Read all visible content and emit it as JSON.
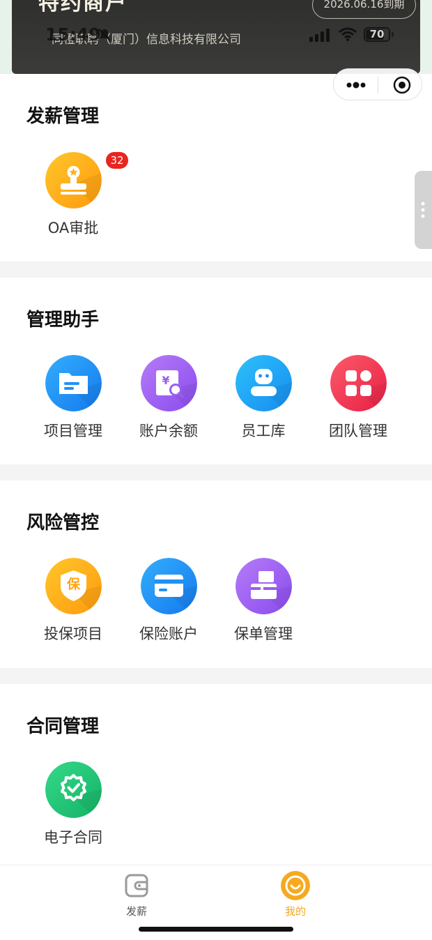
{
  "header": {
    "merchant_title": "特约商户",
    "expiry": "2026.06.16到期",
    "company": "同橙职聘（厦门）信息科技有限公司"
  },
  "status_bar": {
    "time": "15:49",
    "battery": "70"
  },
  "sections": {
    "payroll": {
      "title": "发薪管理",
      "items": [
        {
          "label": "OA审批",
          "badge": "32",
          "icon": "stamp-icon"
        }
      ]
    },
    "assistant": {
      "title": "管理助手",
      "items": [
        {
          "label": "项目管理",
          "icon": "folder-icon"
        },
        {
          "label": "账户余额",
          "icon": "balance-search-icon"
        },
        {
          "label": "员工库",
          "icon": "employee-icon"
        },
        {
          "label": "团队管理",
          "icon": "team-grid-icon"
        }
      ]
    },
    "risk": {
      "title": "风险管控",
      "items": [
        {
          "label": "投保项目",
          "icon": "shield-icon",
          "icon_text": "保"
        },
        {
          "label": "保险账户",
          "icon": "card-icon"
        },
        {
          "label": "保单管理",
          "icon": "policy-printer-icon"
        }
      ]
    },
    "contract": {
      "title": "合同管理",
      "items": [
        {
          "label": "电子合同",
          "icon": "verified-badge-icon"
        }
      ]
    }
  },
  "tabbar": {
    "tabs": [
      {
        "label": "发薪",
        "icon": "wallet-icon",
        "active": false
      },
      {
        "label": "我的",
        "icon": "smile-icon",
        "active": true
      }
    ]
  },
  "colors": {
    "accent_active": "#f4a81d",
    "badge_red": "#e8251e",
    "orange_icon": "#ffb21a",
    "blue_icon": "#1f92f6",
    "purple_icon": "#9a5cf0",
    "red_icon": "#f03a55",
    "green_icon": "#22c77a"
  }
}
